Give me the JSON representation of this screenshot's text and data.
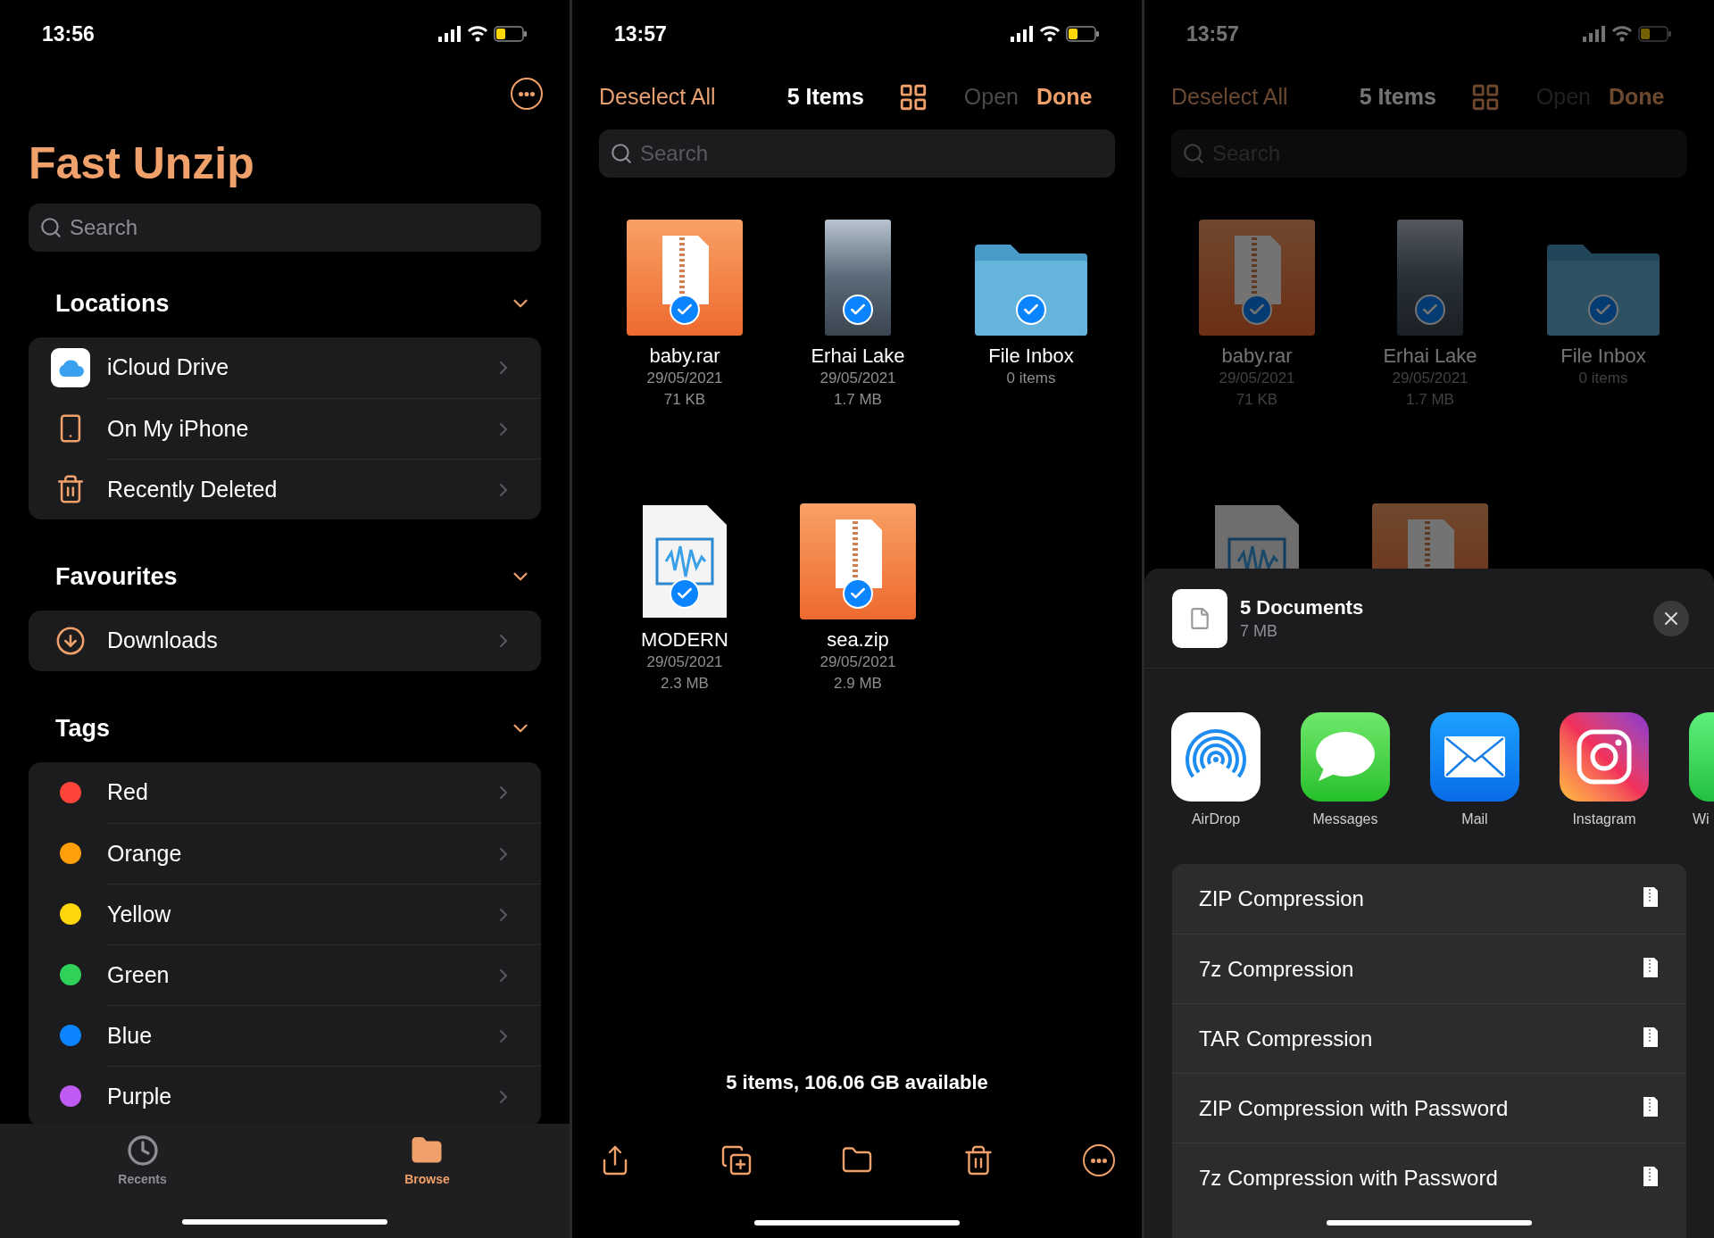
{
  "panels": [
    {
      "kind": "browse",
      "status_time": "13:56",
      "title": "Fast Unzip",
      "search": {
        "placeholder": "Search"
      },
      "sections": [
        {
          "title": "Locations",
          "expanded": true,
          "items": [
            {
              "kind": "icloud",
              "label": "iCloud Drive"
            },
            {
              "kind": "device",
              "label": "On My iPhone"
            },
            {
              "kind": "trash",
              "label": "Recently Deleted"
            }
          ]
        },
        {
          "title": "Favourites",
          "expanded": true,
          "items": [
            {
              "kind": "download",
              "label": "Downloads"
            }
          ]
        },
        {
          "title": "Tags",
          "expanded": true,
          "items": [
            {
              "kind": "tag",
              "label": "Red",
              "color": "#ff453a"
            },
            {
              "kind": "tag",
              "label": "Orange",
              "color": "#ff9f0a"
            },
            {
              "kind": "tag",
              "label": "Yellow",
              "color": "#ffd60a"
            },
            {
              "kind": "tag",
              "label": "Green",
              "color": "#30d158"
            },
            {
              "kind": "tag",
              "label": "Blue",
              "color": "#0a84ff"
            },
            {
              "kind": "tag",
              "label": "Purple",
              "color": "#bf5af2"
            }
          ]
        }
      ],
      "tab_bar": [
        {
          "kind": "recents",
          "label": "Recents",
          "selected": false
        },
        {
          "kind": "browse",
          "label": "Browse",
          "selected": true
        }
      ]
    },
    {
      "kind": "select",
      "status_time": "13:57",
      "toolbar": {
        "deselect": "Deselect All",
        "count": "5 Items",
        "open": {
          "label": "Open",
          "disabled": true
        },
        "done": "Done"
      },
      "search": {
        "placeholder": "Search"
      },
      "files": [
        {
          "kind": "archive",
          "name": "baby.rar",
          "date": "29/05/2021",
          "size": "71 KB",
          "selected": true
        },
        {
          "kind": "photo",
          "name": "Erhai Lake",
          "date": "29/05/2021",
          "size": "1.7 MB",
          "selected": true
        },
        {
          "kind": "folder",
          "name": "File Inbox",
          "date": "0 items",
          "selected": true
        },
        {
          "kind": "audio",
          "name": "MODERN",
          "date": "29/05/2021",
          "size": "2.3 MB",
          "selected": true
        },
        {
          "kind": "archive",
          "name": "sea.zip",
          "date": "29/05/2021",
          "size": "2.9 MB",
          "selected": true
        }
      ],
      "footer": "5 items, 106.06 GB available"
    },
    {
      "kind": "share",
      "status_time": "13:57",
      "toolbar": {
        "deselect": "Deselect All",
        "count": "5 Items",
        "open": {
          "label": "Open",
          "disabled": true
        },
        "done": "Done"
      },
      "search": {
        "placeholder": "Search"
      },
      "files": [
        {
          "kind": "archive",
          "name": "baby.rar",
          "date": "29/05/2021",
          "size": "71 KB",
          "selected": true
        },
        {
          "kind": "photo",
          "name": "Erhai Lake",
          "date": "29/05/2021",
          "size": "1.7 MB",
          "selected": true
        },
        {
          "kind": "folder",
          "name": "File Inbox",
          "date": "0 items",
          "selected": true
        },
        {
          "kind": "audio"
        },
        {
          "kind": "archive"
        }
      ],
      "sheet": {
        "title": "5 Documents",
        "subtitle": "7 MB",
        "apps": [
          {
            "kind": "airdrop",
            "label": "AirDrop"
          },
          {
            "kind": "messages",
            "label": "Messages"
          },
          {
            "kind": "mail",
            "label": "Mail"
          },
          {
            "kind": "instagram",
            "label": "Instagram"
          },
          {
            "kind": "whatsapp",
            "label": "Wi"
          }
        ],
        "actions": [
          "ZIP Compression",
          "7z Compression",
          "TAR Compression",
          "ZIP Compression with Password",
          "7z Compression with Password"
        ]
      }
    }
  ]
}
